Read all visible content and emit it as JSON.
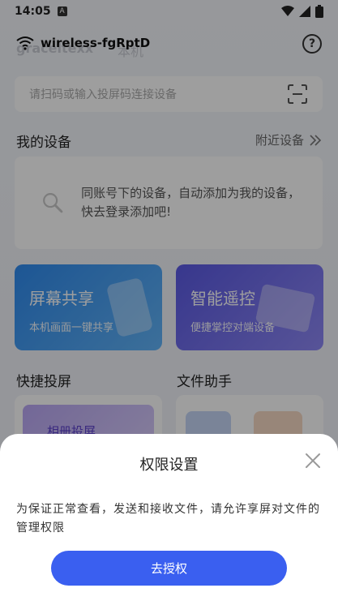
{
  "status_bar": {
    "time": "14:05",
    "notif_badge": "A"
  },
  "top_bar": {
    "network_name": "wireless-fgRptD",
    "ghost_user": "graceltexx",
    "ghost_suffix": "本机"
  },
  "search": {
    "placeholder": "请扫码或输入投屏码连接设备"
  },
  "my_devices": {
    "title": "我的设备",
    "nearby_label": "附近设备",
    "empty_text": "同账号下的设备，自动添加为我的设备，快去登录添加吧!"
  },
  "features": [
    {
      "title": "屏幕共享",
      "subtitle": "本机画面一键共享"
    },
    {
      "title": "智能遥控",
      "subtitle": "便捷掌控对端设备"
    }
  ],
  "quick_cast": {
    "title": "快捷投屏",
    "album_label": "相册投屏"
  },
  "file_helper": {
    "title": "文件助手"
  },
  "dialog": {
    "title": "权限设置",
    "message": "为保证正常查看，发送和接收文件，请允许享屏对文件的管理权限",
    "action_label": "去授权"
  },
  "colors": {
    "primary": "#3a5ff0",
    "screen_share_card": "#2f8bef",
    "remote_card": "#5a59e4"
  }
}
